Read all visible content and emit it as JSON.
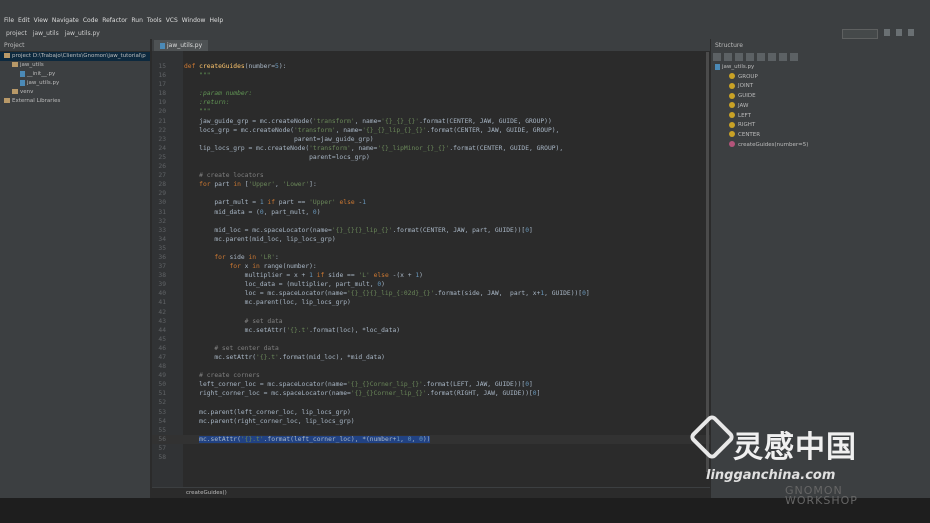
{
  "menu": [
    "File",
    "Edit",
    "View",
    "Navigate",
    "Code",
    "Refactor",
    "Run",
    "Tools",
    "VCS",
    "Window",
    "Help"
  ],
  "breadcrumb": [
    "project",
    "jaw_utils",
    "jaw_utils.py"
  ],
  "project_panel": {
    "title": "Project",
    "tree": [
      {
        "label": "project  D:\\Trabajo\\Clients\\Gnomon\\jaw_tutorial\\p",
        "indent": 0,
        "type": "folder",
        "selected": true
      },
      {
        "label": "jaw_utils",
        "indent": 1,
        "type": "folder",
        "selected": false
      },
      {
        "label": "__init__.py",
        "indent": 2,
        "type": "py",
        "selected": false
      },
      {
        "label": "jaw_utils.py",
        "indent": 2,
        "type": "py",
        "selected": false
      },
      {
        "label": "venv",
        "indent": 1,
        "type": "folder",
        "selected": false
      },
      {
        "label": "External Libraries",
        "indent": 0,
        "type": "lib",
        "selected": false
      }
    ]
  },
  "editor": {
    "tab_label": "jaw_utils.py",
    "status_text": "createGuides()",
    "lines": [
      {
        "n": "15",
        "html": "<span class=\"kw\">def </span><span class=\"fn\">createGuides</span>(number=<span class=\"num\">5</span>):"
      },
      {
        "n": "16",
        "html": "    <span class=\"doc\">\"\"\"</span>"
      },
      {
        "n": "17",
        "html": ""
      },
      {
        "n": "18",
        "html": "    <span class=\"doc\">:param number:</span>"
      },
      {
        "n": "19",
        "html": "    <span class=\"doc\">:return:</span>"
      },
      {
        "n": "20",
        "html": "    <span class=\"doc\">\"\"\"</span>"
      },
      {
        "n": "21",
        "html": "    jaw_guide_grp = mc.createNode(<span class=\"str\">'transform'</span>, name=<span class=\"str\">'{}_{}_{}'</span>.format(CENTER, JAW, GUIDE, GROUP))"
      },
      {
        "n": "22",
        "html": "    locs_grp = mc.createNode(<span class=\"str\">'transform'</span>, name=<span class=\"str\">'{}_{}_lip_{}_{}'</span>.format(CENTER, JAW, GUIDE, GROUP),"
      },
      {
        "n": "23",
        "html": "                             parent=jaw_guide_grp)"
      },
      {
        "n": "24",
        "html": "    lip_locs_grp = mc.createNode(<span class=\"str\">'transform'</span>, name=<span class=\"str\">'{}_lipMinor_{}_{}'</span>.format(CENTER, GUIDE, GROUP),"
      },
      {
        "n": "25",
        "html": "                                 parent=locs_grp)"
      },
      {
        "n": "26",
        "html": ""
      },
      {
        "n": "27",
        "html": "    <span class=\"cmt\"># create locators</span>"
      },
      {
        "n": "28",
        "html": "    <span class=\"kw\">for </span>part <span class=\"kw\">in </span>[<span class=\"str\">'Upper'</span>, <span class=\"str\">'Lower'</span>]:"
      },
      {
        "n": "29",
        "html": ""
      },
      {
        "n": "30",
        "html": "        part_mult = <span class=\"num\">1</span> <span class=\"kw\">if </span>part == <span class=\"str\">'Upper'</span> <span class=\"kw\">else </span>-<span class=\"num\">1</span>"
      },
      {
        "n": "31",
        "html": "        mid_data = (<span class=\"num\">0</span>, part_mult, <span class=\"num\">0</span>)"
      },
      {
        "n": "32",
        "html": ""
      },
      {
        "n": "33",
        "html": "        mid_loc = mc.spaceLocator(name=<span class=\"str\">'{}_{}{}_lip_{}'</span>.format(CENTER, JAW, part, GUIDE))[<span class=\"num\">0</span>]"
      },
      {
        "n": "34",
        "html": "        mc.parent(mid_loc, lip_locs_grp)"
      },
      {
        "n": "35",
        "html": ""
      },
      {
        "n": "36",
        "html": "        <span class=\"kw\">for </span>side <span class=\"kw\">in </span><span class=\"str\">'LR'</span>:"
      },
      {
        "n": "37",
        "html": "            <span class=\"kw\">for </span>x <span class=\"kw\">in </span>range(number):"
      },
      {
        "n": "38",
        "html": "                multiplier = x + <span class=\"num\">1</span> <span class=\"kw\">if </span>side == <span class=\"str\">'L'</span> <span class=\"kw\">else </span>-(x + <span class=\"num\">1</span>)"
      },
      {
        "n": "39",
        "html": "                loc_data = (multiplier, part_mult, <span class=\"num\">0</span>)"
      },
      {
        "n": "40",
        "html": "                loc = mc.spaceLocator(name=<span class=\"str\">'{}_{}{}_lip_{:02d}_{}'</span>.format(side, JAW,  part, x+<span class=\"num\">1</span>, GUIDE))[<span class=\"num\">0</span>]"
      },
      {
        "n": "41",
        "html": "                mc.parent(loc, lip_locs_grp)"
      },
      {
        "n": "42",
        "html": ""
      },
      {
        "n": "43",
        "html": "                <span class=\"cmt\"># set data</span>"
      },
      {
        "n": "44",
        "html": "                mc.setAttr(<span class=\"str\">'{}.t'</span>.format(loc), *loc_data)"
      },
      {
        "n": "45",
        "html": ""
      },
      {
        "n": "46",
        "html": "        <span class=\"cmt\"># set center data</span>"
      },
      {
        "n": "47",
        "html": "        mc.setAttr(<span class=\"str\">'{}.t'</span>.format(mid_loc), *mid_data)"
      },
      {
        "n": "48",
        "html": ""
      },
      {
        "n": "49",
        "html": "    <span class=\"cmt\"># create corners</span>"
      },
      {
        "n": "50",
        "html": "    left_corner_loc = mc.spaceLocator(name=<span class=\"str\">'{}_{}Corner_lip_{}'</span>.format(LEFT, JAW, GUIDE))[<span class=\"num\">0</span>]"
      },
      {
        "n": "51",
        "html": "    right_corner_loc = mc.spaceLocator(name=<span class=\"str\">'{}_{}Corner_lip_{}'</span>.format(RIGHT, JAW, GUIDE))[<span class=\"num\">0</span>]"
      },
      {
        "n": "52",
        "html": ""
      },
      {
        "n": "53",
        "html": "    mc.parent(left_corner_loc, lip_locs_grp)"
      },
      {
        "n": "54",
        "html": "    mc.parent(right_corner_loc, lip_locs_grp)"
      },
      {
        "n": "55",
        "html": ""
      },
      {
        "n": "56",
        "html": "    <span class=\"hl\">mc.setAttr(<span class=\"str\">'{}.t'</span>.format(left_corner_loc), *(number+<span class=\"num\">1</span>, <span class=\"num\">0</span>, <span class=\"num\">0</span>))</span>",
        "current": true
      },
      {
        "n": "57",
        "html": ""
      },
      {
        "n": "58",
        "html": ""
      }
    ]
  },
  "structure_panel": {
    "title": "Structure",
    "root": "jaw_utils.py",
    "items": [
      {
        "label": "GROUP",
        "kind": "var"
      },
      {
        "label": "JOINT",
        "kind": "var"
      },
      {
        "label": "GUIDE",
        "kind": "var"
      },
      {
        "label": "JAW",
        "kind": "var"
      },
      {
        "label": "LEFT",
        "kind": "var"
      },
      {
        "label": "RIGHT",
        "kind": "var"
      },
      {
        "label": "CENTER",
        "kind": "var"
      },
      {
        "label": "createGuides(number=5)",
        "kind": "func"
      }
    ]
  },
  "watermark": {
    "cn_text": "灵感中国",
    "url": "lingganchina.com",
    "gnomon_line1": "GNOMON",
    "gnomon_line2": "WORKSHOP"
  }
}
